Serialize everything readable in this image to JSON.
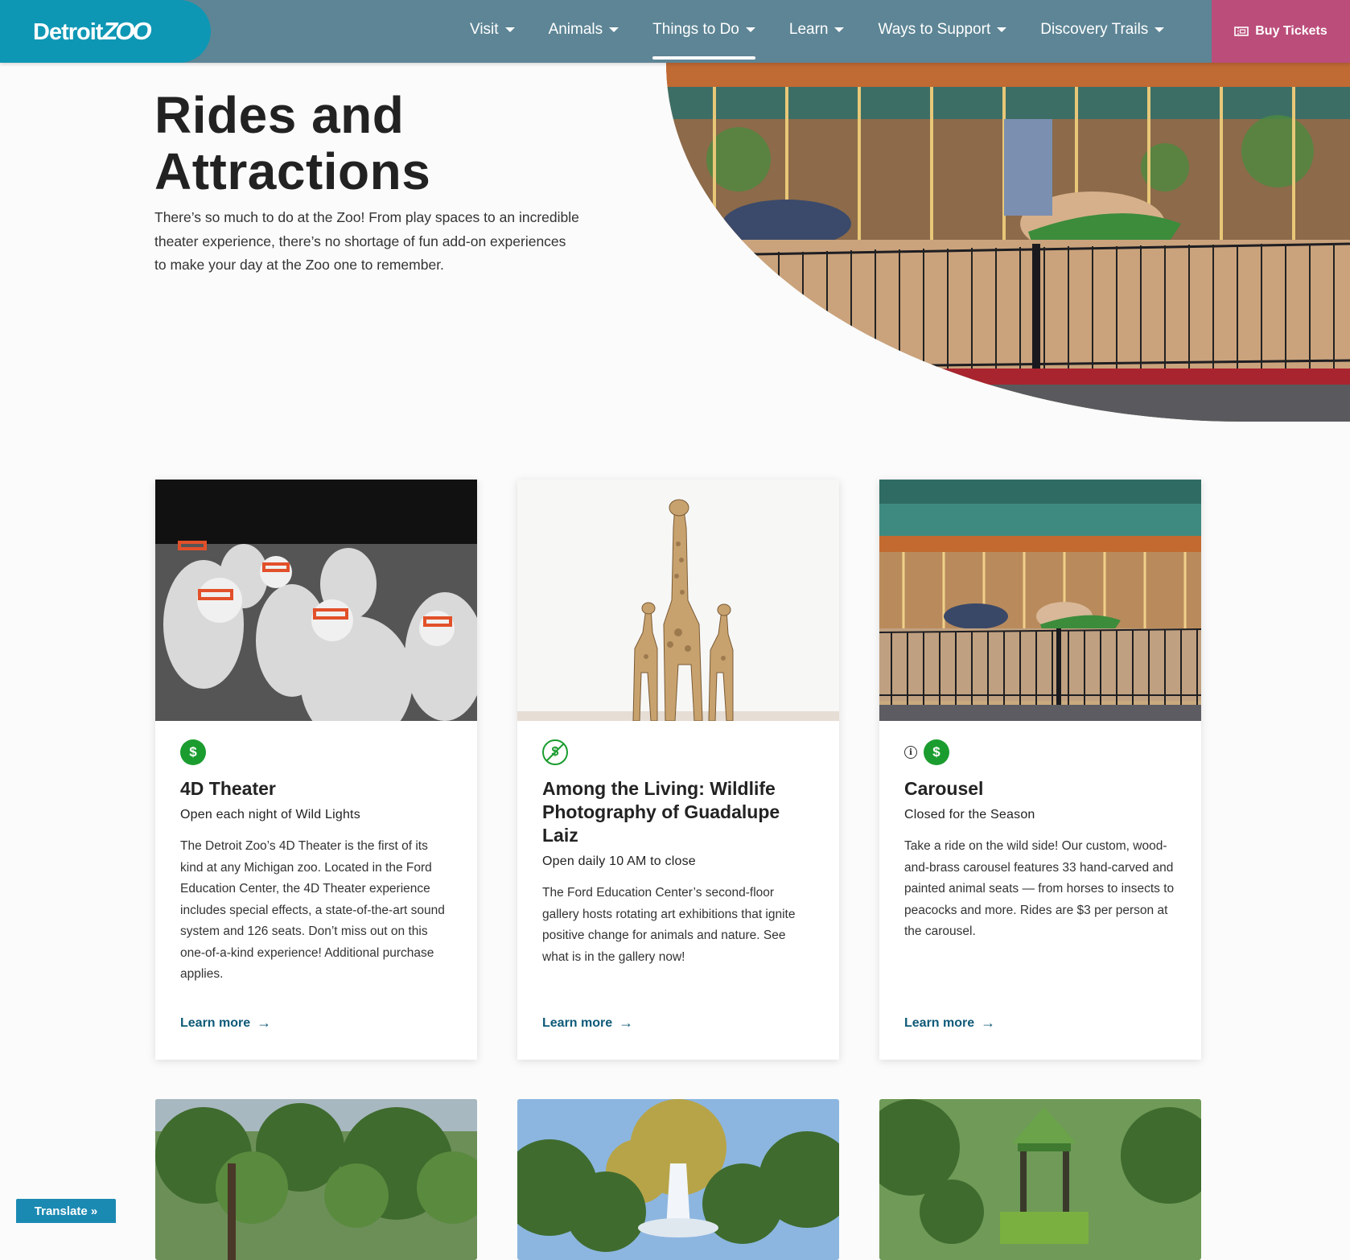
{
  "header": {
    "logo_text": "Detroit",
    "logo_zoo": "ZOO",
    "nav": [
      {
        "label": "Visit"
      },
      {
        "label": "Animals"
      },
      {
        "label": "Things to Do"
      },
      {
        "label": "Learn"
      },
      {
        "label": "Ways to Support"
      },
      {
        "label": "Discovery Trails"
      }
    ],
    "active_nav": "Things to Do",
    "buy_tickets": "Buy Tickets"
  },
  "hero": {
    "title": "Rides and Attractions",
    "text": "There’s so much to do at the Zoo! From play spaces to an incredible theater experience, there’s no shortage of fun add-on experiences to make your day at the Zoo one to remember."
  },
  "cards": [
    {
      "title": "4D Theater",
      "subtitle": "Open each night of Wild Lights",
      "description": "The Detroit Zoo’s 4D Theater is the first of its kind at any Michigan zoo. Located in the Ford Education Center, the 4D Theater experience includes special effects, a state-of-the-art sound system and 126 seats. Don’t miss out on this one-of-a-kind experience! Additional purchase applies.",
      "link": "Learn more",
      "icons": [
        "dollar-icon"
      ]
    },
    {
      "title": "Among the Living: Wildlife Photography of Guadalupe Laiz",
      "subtitle": "Open daily 10 AM to close",
      "description": "The Ford Education Center’s second-floor gallery hosts rotating art exhibitions that ignite positive change for animals and nature. See what is in the gallery now!",
      "link": "Learn more",
      "icons": [
        "no-dollar-icon"
      ]
    },
    {
      "title": "Carousel",
      "subtitle": "Closed for the Season",
      "description": "Take a ride on the wild side! Our custom, wood-and-brass carousel features 33 hand-carved and painted animal seats — from horses to insects to peacocks and more. Rides are $3 per person at the carousel.",
      "link": "Learn more",
      "icons": [
        "info-icon",
        "dollar-icon"
      ]
    }
  ],
  "icon_glyphs": {
    "dollar": "$",
    "info": "i",
    "arrow": "→"
  },
  "translate": "Translate »",
  "colors": {
    "header_bg": "#5d8595",
    "logo_bg": "#0e97b5",
    "buy_bg": "#bb4d7a",
    "badge_green": "#1b9c2f",
    "link": "#0f5a78",
    "translate_bg": "#1b8ab3"
  }
}
